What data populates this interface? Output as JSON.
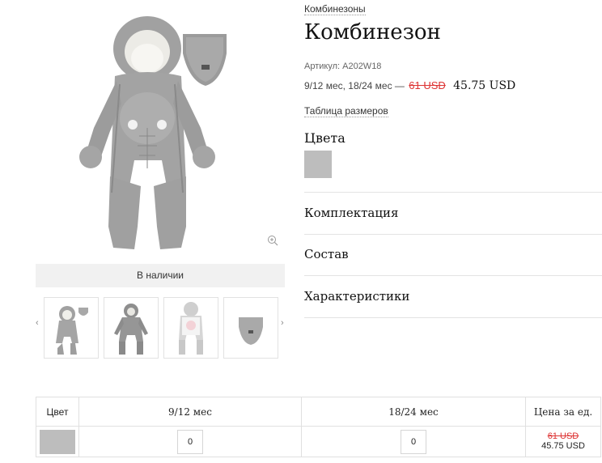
{
  "product": {
    "breadcrumb": "Комбинезоны",
    "title": "Комбинезон",
    "sku": "Артикул: A202W18",
    "sizes_text": "9/12 мес, 18/24 мес —",
    "old_price": "61 USD",
    "new_price": "45.75 USD",
    "size_table_link": "Таблица размеров",
    "colors_title": "Цвета",
    "swatch_color": "#bdbdbd"
  },
  "gallery": {
    "stock_status": "В наличии",
    "prev_arrow": "‹",
    "next_arrow": "›",
    "thumbnails": [
      "jumpsuit-with-bib",
      "jumpsuit-front",
      "jumpsuit-open-with-pillow",
      "bib"
    ]
  },
  "accordion": [
    "Комплектация",
    "Состав",
    "Характеристики"
  ],
  "order_table": {
    "headers": [
      "Цвет",
      "9/12 мес",
      "18/24 мес",
      "Цена за ед."
    ],
    "row": {
      "qty_1": "0",
      "qty_2": "0",
      "old_price": "61 USD",
      "new_price": "45.75 USD"
    }
  }
}
